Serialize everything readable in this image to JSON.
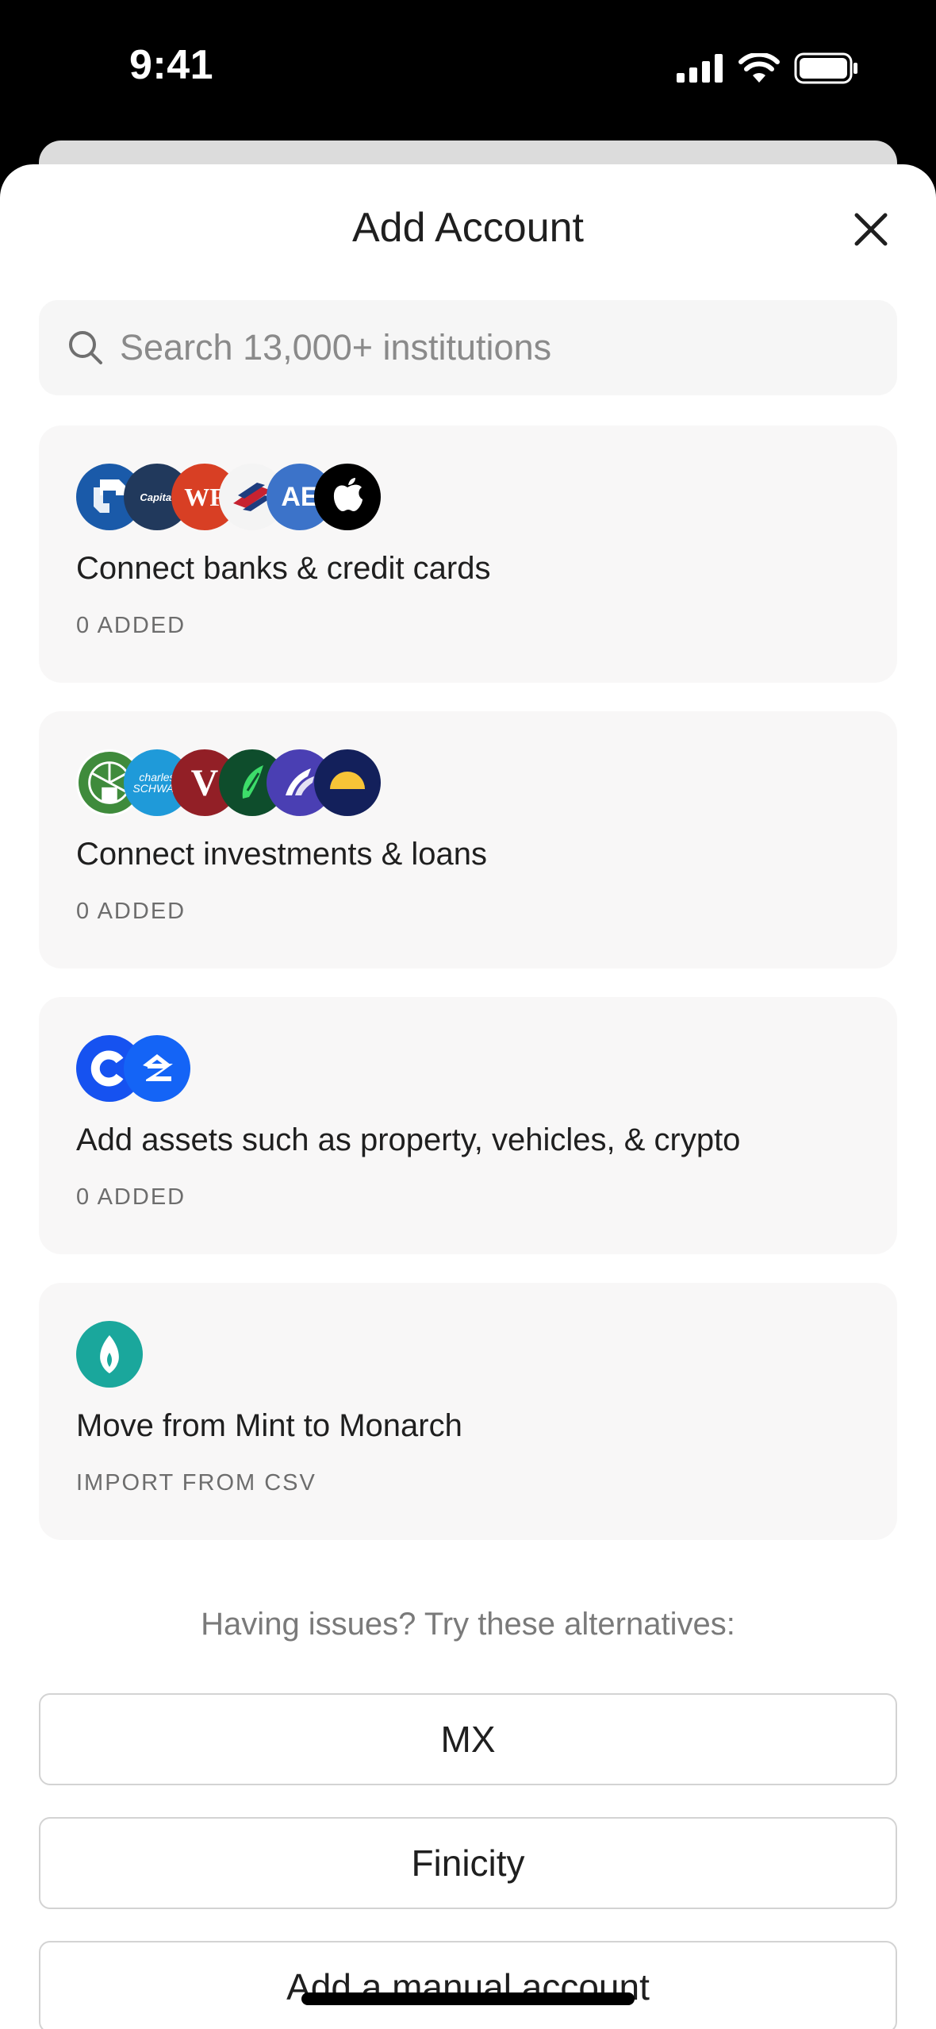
{
  "status_bar": {
    "time": "9:41"
  },
  "sheet": {
    "title": "Add Account",
    "close_icon": "close-icon"
  },
  "search": {
    "placeholder": "Search 13,000+ institutions",
    "icon": "search-icon"
  },
  "cards": [
    {
      "title": "Connect banks & credit cards",
      "subtitle": "0 ADDED",
      "logos": [
        {
          "name": "chase-logo",
          "label": "",
          "bg": "#1a5aa9"
        },
        {
          "name": "capital-one-logo",
          "label": "Capital",
          "bg": "#21395c"
        },
        {
          "name": "wells-fargo-logo",
          "label": "WF",
          "bg": "#d83f24"
        },
        {
          "name": "bank-of-america-logo",
          "label": "",
          "bg": "#f2f2f2"
        },
        {
          "name": "american-express-logo",
          "label": "AE",
          "bg": "#3c73c9"
        },
        {
          "name": "apple-logo",
          "label": "",
          "bg": "#000000"
        }
      ]
    },
    {
      "title": "Connect investments & loans",
      "subtitle": "0 ADDED",
      "logos": [
        {
          "name": "fidelity-logo",
          "label": "",
          "bg": "#3f8b3c"
        },
        {
          "name": "charles-schwab-logo",
          "label": "charles SCHWAB",
          "bg": "#1f9ad9"
        },
        {
          "name": "vanguard-logo",
          "label": "V",
          "bg": "#921f26"
        },
        {
          "name": "robinhood-logo",
          "label": "",
          "bg": "#0e4d2c"
        },
        {
          "name": "wealthfront-logo",
          "label": "",
          "bg": "#4a3fb3"
        },
        {
          "name": "betterment-logo",
          "label": "",
          "bg": "#13205b"
        }
      ]
    },
    {
      "title": "Add assets such as property, vehicles, & crypto",
      "subtitle": "0 ADDED",
      "logos": [
        {
          "name": "coinbase-logo",
          "label": "",
          "bg": "#1652f0"
        },
        {
          "name": "zillow-logo",
          "label": "",
          "bg": "#1464f6"
        }
      ]
    },
    {
      "title": "Move from Mint to Monarch",
      "subtitle": "IMPORT FROM CSV",
      "logos": [
        {
          "name": "mint-logo",
          "label": "",
          "bg": "#1aa79c"
        }
      ]
    }
  ],
  "alternatives": {
    "heading": "Having issues? Try these alternatives:",
    "buttons": [
      "MX",
      "Finicity",
      "Add a manual account"
    ]
  }
}
